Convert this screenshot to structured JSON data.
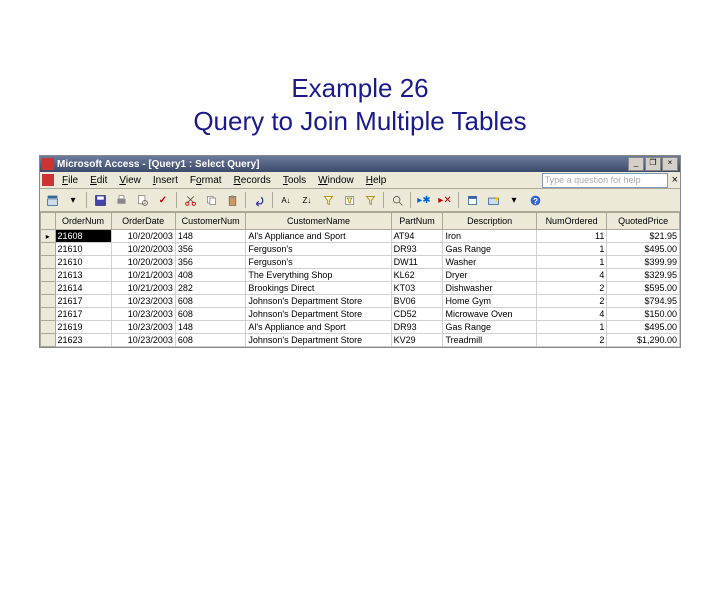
{
  "slide": {
    "line1": "Example 26",
    "line2": "Query to Join Multiple Tables"
  },
  "window": {
    "title": "Microsoft Access - [Query1 : Select Query]",
    "help_placeholder": "Type a question for help",
    "win_min": "_",
    "win_max": "❐",
    "win_close": "×"
  },
  "menu": {
    "file": "File",
    "edit": "Edit",
    "view": "View",
    "insert": "Insert",
    "format": "Format",
    "records": "Records",
    "tools": "Tools",
    "window": "Window",
    "help": "Help"
  },
  "columns": [
    "OrderNum",
    "OrderDate",
    "CustomerNum",
    "CustomerName",
    "PartNum",
    "Description",
    "NumOrdered",
    "QuotedPrice"
  ],
  "rows": [
    {
      "sel": true,
      "OrderNum": "21608",
      "OrderDate": "10/20/2003",
      "CustomerNum": "148",
      "CustomerName": "Al's Appliance and Sport",
      "PartNum": "AT94",
      "Description": "Iron",
      "NumOrdered": "11",
      "QuotedPrice": "$21.95"
    },
    {
      "OrderNum": "21610",
      "OrderDate": "10/20/2003",
      "CustomerNum": "356",
      "CustomerName": "Ferguson's",
      "PartNum": "DR93",
      "Description": "Gas Range",
      "NumOrdered": "1",
      "QuotedPrice": "$495.00"
    },
    {
      "OrderNum": "21610",
      "OrderDate": "10/20/2003",
      "CustomerNum": "356",
      "CustomerName": "Ferguson's",
      "PartNum": "DW11",
      "Description": "Washer",
      "NumOrdered": "1",
      "QuotedPrice": "$399.99"
    },
    {
      "OrderNum": "21613",
      "OrderDate": "10/21/2003",
      "CustomerNum": "408",
      "CustomerName": "The Everything Shop",
      "PartNum": "KL62",
      "Description": "Dryer",
      "NumOrdered": "4",
      "QuotedPrice": "$329.95"
    },
    {
      "OrderNum": "21614",
      "OrderDate": "10/21/2003",
      "CustomerNum": "282",
      "CustomerName": "Brookings Direct",
      "PartNum": "KT03",
      "Description": "Dishwasher",
      "NumOrdered": "2",
      "QuotedPrice": "$595.00"
    },
    {
      "OrderNum": "21617",
      "OrderDate": "10/23/2003",
      "CustomerNum": "608",
      "CustomerName": "Johnson's Department Store",
      "PartNum": "BV06",
      "Description": "Home Gym",
      "NumOrdered": "2",
      "QuotedPrice": "$794.95"
    },
    {
      "OrderNum": "21617",
      "OrderDate": "10/23/2003",
      "CustomerNum": "608",
      "CustomerName": "Johnson's Department Store",
      "PartNum": "CD52",
      "Description": "Microwave Oven",
      "NumOrdered": "4",
      "QuotedPrice": "$150.00"
    },
    {
      "OrderNum": "21619",
      "OrderDate": "10/23/2003",
      "CustomerNum": "148",
      "CustomerName": "Al's Appliance and Sport",
      "PartNum": "DR93",
      "Description": "Gas Range",
      "NumOrdered": "1",
      "QuotedPrice": "$495.00"
    },
    {
      "OrderNum": "21623",
      "OrderDate": "10/23/2003",
      "CustomerNum": "608",
      "CustomerName": "Johnson's Department Store",
      "PartNum": "KV29",
      "Description": "Treadmill",
      "NumOrdered": "2",
      "QuotedPrice": "$1,290.00"
    }
  ]
}
